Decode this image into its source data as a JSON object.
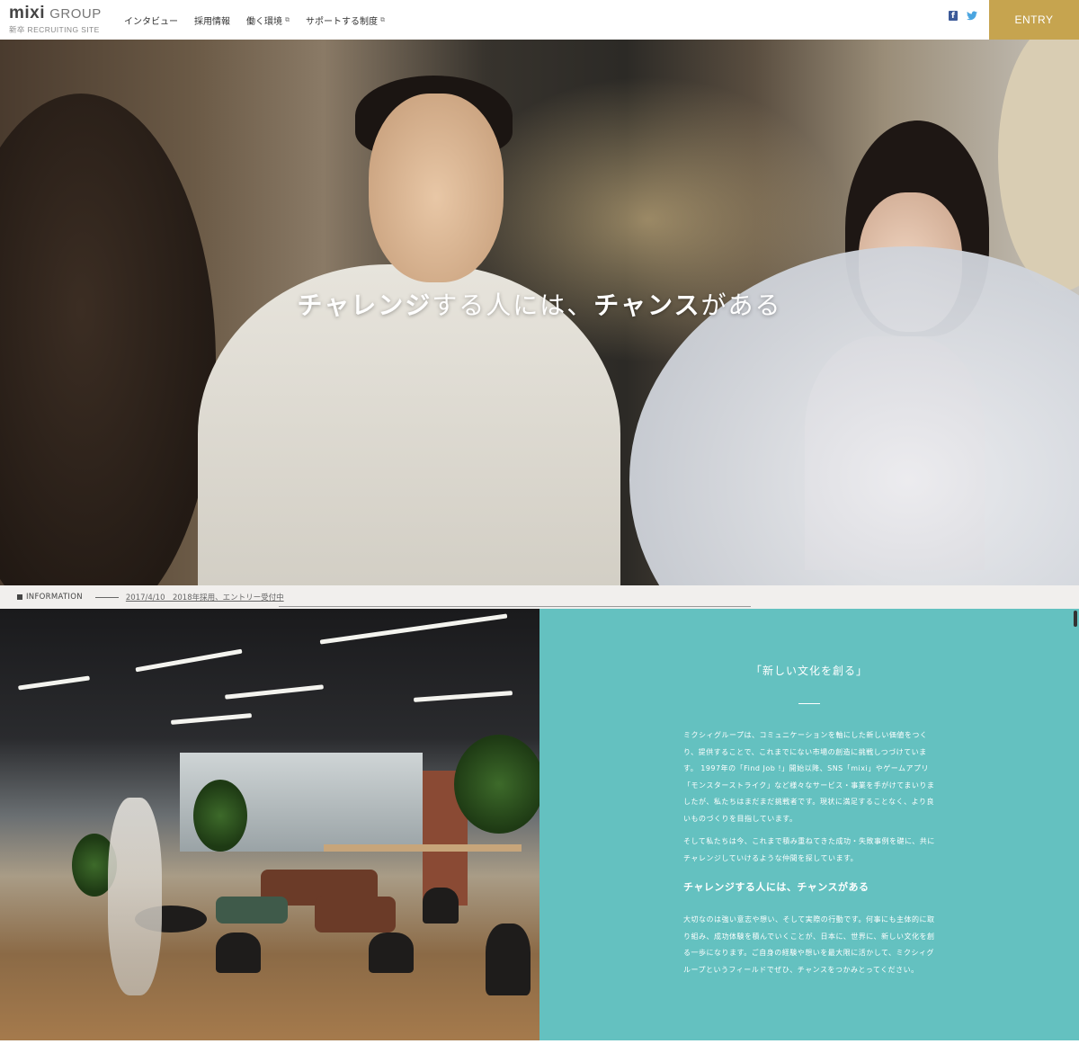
{
  "header": {
    "logo_brand": "mixi",
    "logo_group": "GROUP",
    "logo_sub": "新卒 RECRUITING SITE",
    "nav": [
      {
        "label": "インタビュー",
        "external": false
      },
      {
        "label": "採用情報",
        "external": false
      },
      {
        "label": "働く環境",
        "external": true
      },
      {
        "label": "サポートする制度",
        "external": true
      }
    ],
    "external_glyph": "⧉",
    "social": {
      "facebook_glyph": "f",
      "twitter_glyph": "🐦"
    },
    "entry_label": "ENTRY",
    "entry_color": "#c6a44f"
  },
  "hero": {
    "copy_part1": "チャレンジ",
    "copy_part2": "する人には、",
    "copy_part3": "チャンス",
    "copy_part4": "がある"
  },
  "info": {
    "label": "INFORMATION",
    "news": "2017/4/10　2018年採用、エントリー受付中"
  },
  "panel": {
    "bg_color": "#64c1c0",
    "title": "「新しい文化を創る」",
    "body1": "ミクシィグループは、コミュニケーションを軸にした新しい価値をつくり、提供することで、これまでにない市場の創造に挑戦しつづけています。 1997年の「Find Job !」開始以降、SNS「mixi」やゲームアプリ「モンスターストライク」など様々なサービス・事業を手がけてまいりましたが、私たちはまだまだ挑戦者です。現状に満足することなく、より良いものづくりを目指しています。",
    "body2": "そして私たちは今、これまで積み重ねてきた成功・失敗事例を礎に、共にチャレンジしていけるような仲間を探しています。",
    "heading": "チャレンジする人には、チャンスがある",
    "body3": "大切なのは強い意志や想い、そして実際の行動です。何事にも主体的に取り組み、成功体験を積んでいくことが、日本に、世界に、新しい文化を創る一歩になります。ご自身の経験や想いを最大限に活かして、ミクシィグループというフィールドでぜひ、チャンスをつかみとってください。"
  }
}
